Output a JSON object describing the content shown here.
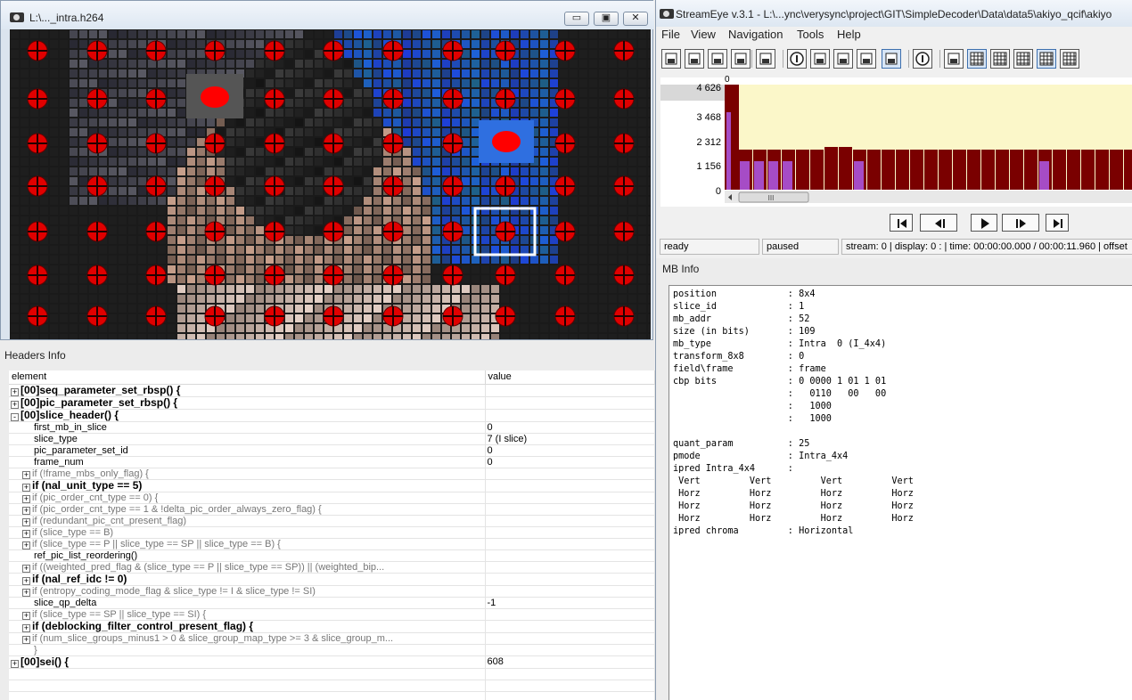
{
  "video_window": {
    "title": "L:\\..._intra.h264",
    "buttons": {
      "minimize": "▭",
      "maximize": "▣",
      "close": "✕"
    }
  },
  "headers_info": {
    "title": "Headers Info",
    "columns": [
      "element",
      "value"
    ],
    "rows": [
      {
        "element": "[00]seq_parameter_set_rbsp() {",
        "value": "",
        "indent": 0,
        "toggle": "+",
        "style": "bold"
      },
      {
        "element": "[00]pic_parameter_set_rbsp() {",
        "value": "",
        "indent": 0,
        "toggle": "+",
        "style": "bold"
      },
      {
        "element": "[00]slice_header() {",
        "value": "",
        "indent": 0,
        "toggle": "-",
        "style": "bold"
      },
      {
        "element": "first_mb_in_slice",
        "value": "0",
        "indent": 2,
        "toggle": "",
        "style": ""
      },
      {
        "element": "slice_type",
        "value": "7 (I slice)",
        "indent": 2,
        "toggle": "",
        "style": ""
      },
      {
        "element": "pic_parameter_set_id",
        "value": "0",
        "indent": 2,
        "toggle": "",
        "style": ""
      },
      {
        "element": "frame_num",
        "value": "0",
        "indent": 2,
        "toggle": "",
        "style": ""
      },
      {
        "element": "if (!frame_mbs_only_flag) {",
        "value": "",
        "indent": 1,
        "toggle": "+",
        "style": "gray"
      },
      {
        "element": "if (nal_unit_type == 5)",
        "value": "",
        "indent": 1,
        "toggle": "+",
        "style": "bold"
      },
      {
        "element": "if (pic_order_cnt_type == 0) {",
        "value": "",
        "indent": 1,
        "toggle": "+",
        "style": "gray"
      },
      {
        "element": "if (pic_order_cnt_type == 1 & !delta_pic_order_always_zero_flag) {",
        "value": "",
        "indent": 1,
        "toggle": "+",
        "style": "gray"
      },
      {
        "element": "if (redundant_pic_cnt_present_flag)",
        "value": "",
        "indent": 1,
        "toggle": "+",
        "style": "gray"
      },
      {
        "element": "if (slice_type == B)",
        "value": "",
        "indent": 1,
        "toggle": "+",
        "style": "gray"
      },
      {
        "element": "if (slice_type == P || slice_type == SP || slice_type == B) {",
        "value": "",
        "indent": 1,
        "toggle": "+",
        "style": "gray"
      },
      {
        "element": "ref_pic_list_reordering()",
        "value": "",
        "indent": 2,
        "toggle": "",
        "style": ""
      },
      {
        "element": "if ((weighted_pred_flag & (slice_type == P || slice_type == SP)) || (weighted_bip...",
        "value": "",
        "indent": 1,
        "toggle": "+",
        "style": "gray"
      },
      {
        "element": "if (nal_ref_idc != 0)",
        "value": "",
        "indent": 1,
        "toggle": "+",
        "style": "bold"
      },
      {
        "element": "if (entropy_coding_mode_flag & slice_type != I & slice_type != SI)",
        "value": "",
        "indent": 1,
        "toggle": "+",
        "style": "gray"
      },
      {
        "element": "slice_qp_delta",
        "value": "-1",
        "indent": 2,
        "toggle": "",
        "style": ""
      },
      {
        "element": "if (slice_type == SP || slice_type == SI) {",
        "value": "",
        "indent": 1,
        "toggle": "+",
        "style": "gray"
      },
      {
        "element": "if (deblocking_filter_control_present_flag) {",
        "value": "",
        "indent": 1,
        "toggle": "+",
        "style": "bold"
      },
      {
        "element": "if (num_slice_groups_minus1 > 0 & slice_group_map_type >= 3 & slice_group_m...",
        "value": "",
        "indent": 1,
        "toggle": "+",
        "style": "gray"
      },
      {
        "element": "}",
        "value": "",
        "indent": 2,
        "toggle": "",
        "style": "gray"
      },
      {
        "element": "[00]sei() {",
        "value": "608",
        "indent": 0,
        "toggle": "+",
        "style": "bold"
      }
    ]
  },
  "streameye": {
    "title": "StreamEye v.3.1 - L:\\...ync\\verysync\\project\\GIT\\SimpleDecoder\\Data\\data5\\akiyo_qcif\\akiyo",
    "menu": [
      "File",
      "View",
      "Navigation",
      "Tools",
      "Help"
    ],
    "toolbar_icons": [
      "open-icon",
      "reload-icon",
      "save-icon",
      "export-icon",
      "close-file-icon",
      "filter-icon",
      "frame-view-icon",
      "split-view-icon",
      "chart-icon",
      "folder-icon",
      "info-icon",
      "picture-icon",
      "grid-icon",
      "grid-arrow-icon",
      "macroblock-grid-icon",
      "macroblock-partition-icon",
      "macroblock-type-icon"
    ],
    "graph": {
      "y_ticks": [
        "4 626",
        "3 468",
        "2 312",
        "1 156",
        "0"
      ],
      "x_start_label": "0",
      "scroll_grip": "III",
      "colors": {
        "background": "#fbf7c9",
        "i_frame": "#a64cc6",
        "bar": "#7a0000"
      }
    },
    "transport": [
      "first-frame-icon",
      "prev-frame-icon",
      "play-icon",
      "next-frame-icon",
      "last-frame-icon"
    ],
    "status": {
      "state": "ready",
      "playback": "paused",
      "info": "stream: 0 | display: 0 : | time: 00:00:00.000 / 00:00:11.960 | offset"
    }
  },
  "mb_info": {
    "title": "MB Info",
    "lines": [
      "position             : 8x4",
      "slice_id             : 1",
      "mb_addr              : 52",
      "size (in bits)       : 109",
      "mb_type              : Intra  0 (I_4x4)",
      "transform_8x8        : 0",
      "field\\frame          : frame",
      "cbp bits             : 0 0000 1 01 1 01",
      "                     :   0110   00   00",
      "                     :   1000",
      "                     :   1000",
      "",
      "quant_param          : 25",
      "pmode                : Intra_4x4",
      "ipred Intra_4x4      :",
      " Vert         Vert         Vert         Vert",
      " Horz         Horz         Horz         Horz",
      " Horz         Horz         Horz         Horz",
      " Horz         Horz         Horz         Horz",
      "ipred chroma         : Horizontal"
    ]
  }
}
